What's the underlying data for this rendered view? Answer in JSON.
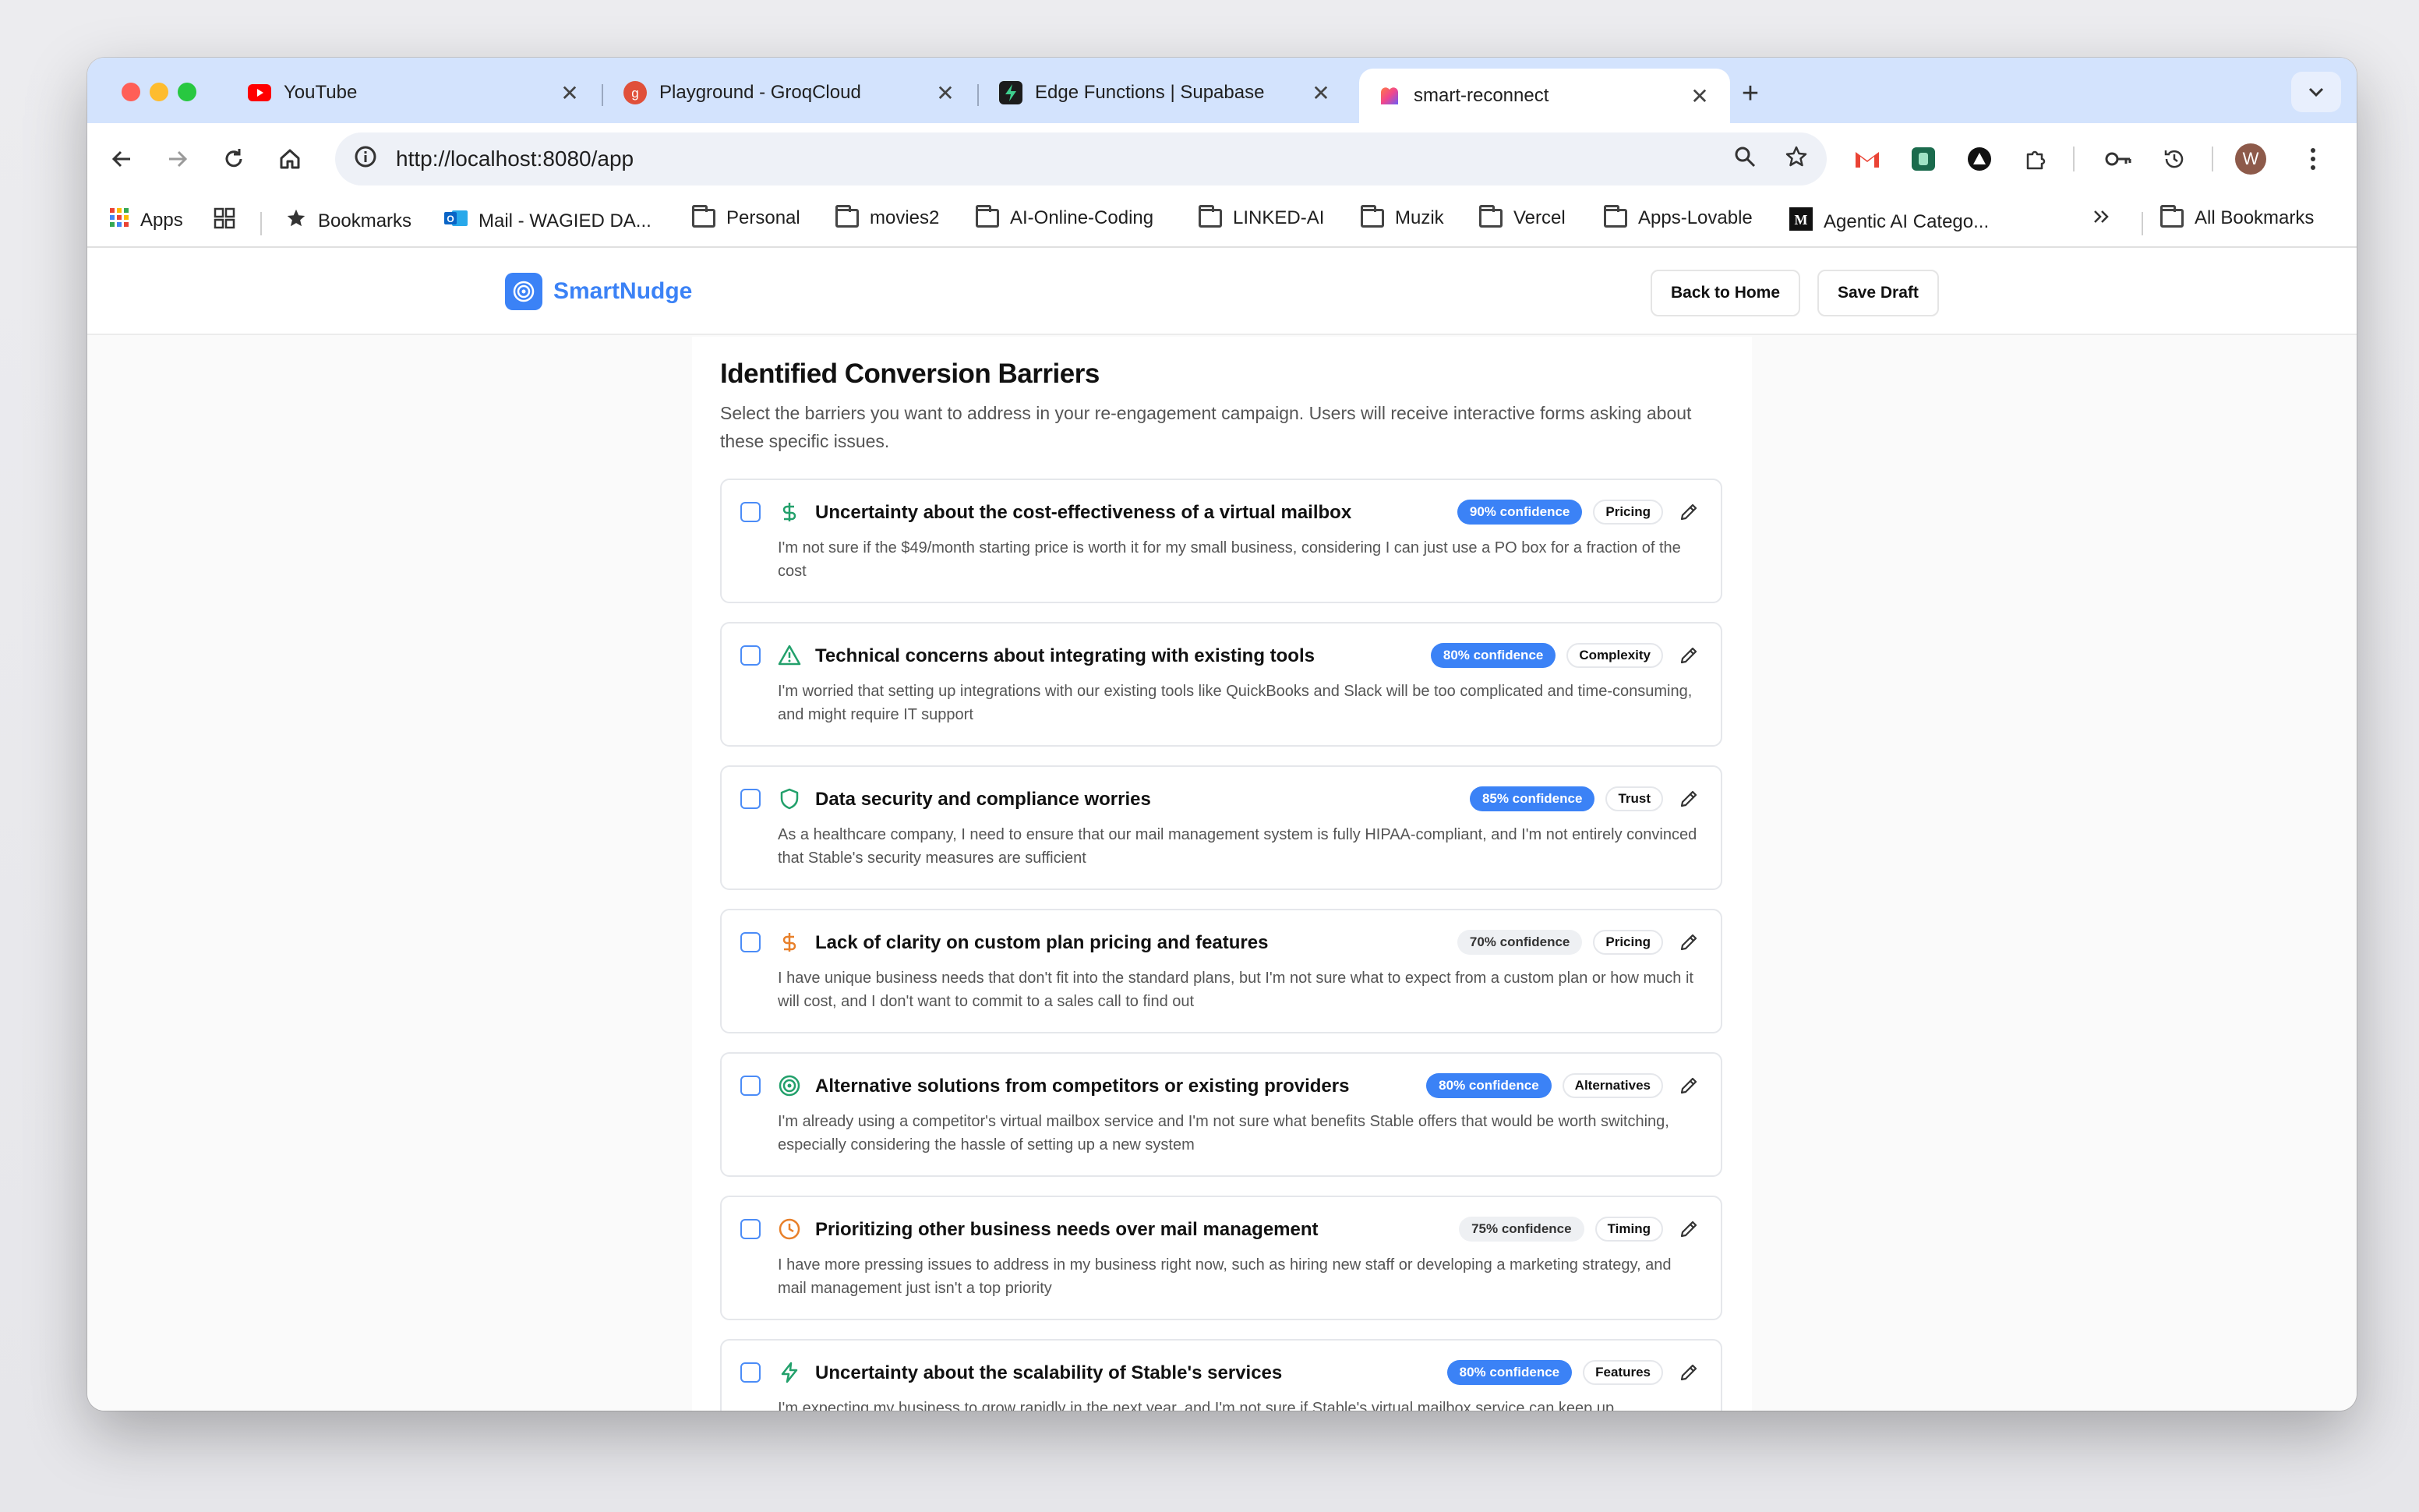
{
  "browser": {
    "tabs": [
      {
        "title": "YouTube",
        "icon": "youtube-icon"
      },
      {
        "title": "Playground - GroqCloud",
        "icon": "groq-icon"
      },
      {
        "title": "Edge Functions | Supabase",
        "icon": "supabase-icon"
      },
      {
        "title": "smart-reconnect",
        "icon": "lovable-icon",
        "active": true
      }
    ],
    "url": "http://localhost:8080/app",
    "profile_initial": "W",
    "bookmarks": {
      "apps": "Apps",
      "bookmarks": "Bookmarks",
      "mail": "Mail - WAGIED DA...",
      "personal": "Personal",
      "movies2": "movies2",
      "ai_online_coding": "AI-Online-Coding",
      "linked_ai": "LINKED-AI",
      "muzik": "Muzik",
      "vercel": "Vercel",
      "apps_lovable": "Apps-Lovable",
      "agentic": "Agentic AI Catego...",
      "all_bookmarks": "All Bookmarks"
    }
  },
  "app": {
    "brand": "SmartNudge",
    "back_button": "Back to Home",
    "save_button": "Save Draft",
    "title": "Identified Conversion Barriers",
    "subtitle": "Select the barriers you want to address in your re-engagement campaign. Users will receive interactive forms asking about these specific issues.",
    "barriers": [
      {
        "title": "Uncertainty about the cost-effectiveness of a virtual mailbox",
        "confidence": "90% confidence",
        "category": "Pricing",
        "icon": "dollar-icon",
        "description": "I'm not sure if the $49/month starting price is worth it for my small business, considering I can just use a PO box for a fraction of the cost"
      },
      {
        "title": "Technical concerns about integrating with existing tools",
        "confidence": "80% confidence",
        "category": "Complexity",
        "icon": "warning-triangle-icon",
        "description": "I'm worried that setting up integrations with our existing tools like QuickBooks and Slack will be too complicated and time-consuming, and might require IT support"
      },
      {
        "title": "Data security and compliance worries",
        "confidence": "85% confidence",
        "category": "Trust",
        "icon": "shield-icon",
        "description": "As a healthcare company, I need to ensure that our mail management system is fully HIPAA-compliant, and I'm not entirely convinced that Stable's security measures are sufficient"
      },
      {
        "title": "Lack of clarity on custom plan pricing and features",
        "confidence": "70% confidence",
        "category": "Pricing",
        "icon": "dollar-icon",
        "description": "I have unique business needs that don't fit into the standard plans, but I'm not sure what to expect from a custom plan or how much it will cost, and I don't want to commit to a sales call to find out"
      },
      {
        "title": "Alternative solutions from competitors or existing providers",
        "confidence": "80% confidence",
        "category": "Alternatives",
        "icon": "target-icon",
        "description": "I'm already using a competitor's virtual mailbox service and I'm not sure what benefits Stable offers that would be worth switching, especially considering the hassle of setting up a new system"
      },
      {
        "title": "Prioritizing other business needs over mail management",
        "confidence": "75% confidence",
        "category": "Timing",
        "icon": "clock-icon",
        "description": "I have more pressing issues to address in my business right now, such as hiring new staff or developing a marketing strategy, and mail management just isn't a top priority"
      },
      {
        "title": "Uncertainty about the scalability of Stable's services",
        "confidence": "80% confidence",
        "category": "Features",
        "icon": "lightning-icon",
        "description": "I'm expecting my business to grow rapidly in the next year, and I'm not sure if Stable's virtual mailbox service can keep up"
      }
    ]
  },
  "colors": {
    "brand": "#3b82f6",
    "icon_green": "#22a06b",
    "icon_orange": "#e8802a"
  }
}
